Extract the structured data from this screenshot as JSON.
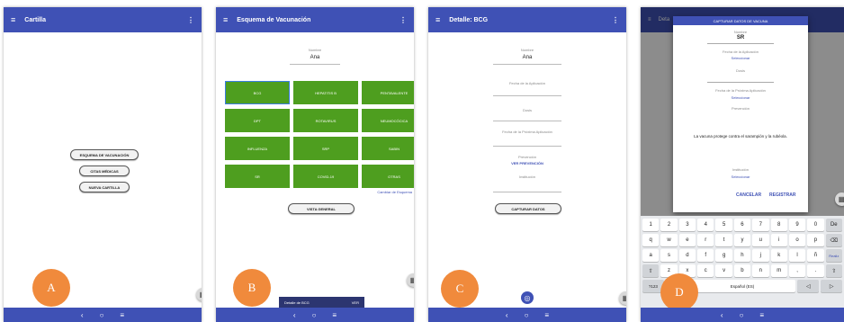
{
  "nav": {
    "back": "‹",
    "home": "○",
    "recents": "≡"
  },
  "icons": {
    "menu": "≡",
    "more": "⋮",
    "qr": "▦"
  },
  "screen_a": {
    "title": "Cartilla",
    "buttons": [
      "ESQUEMA DE VACUNACIÓN",
      "CITAS MÉDICAS",
      "NUEVA CARTILLA"
    ],
    "letter": "A"
  },
  "screen_b": {
    "title": "Esquema de Vacunación",
    "name_label": "Nombre",
    "name_value": "Ana",
    "vaccines": [
      "BCG",
      "HEPATITIS B",
      "PENTAVALENTE",
      "DPT",
      "ROTAVIRUS",
      "NEUMOCÓCICA",
      "INFLUENZA",
      "SRP",
      "SABIN",
      "SR",
      "COVID-19",
      "OTRAS"
    ],
    "selected_vaccine": "BCG",
    "change_link": "Cambiar de Esquema",
    "general_button": "VISTA GENERAL",
    "snackbar_text": "Detalle de BCG",
    "snackbar_action": "VER",
    "letter": "B"
  },
  "screen_c": {
    "title": "Detalle: BCG",
    "name_label": "Nombre",
    "name_value": "Ana",
    "field_fecha": "Fecha de la Aplicación",
    "field_dosis": "Dosis",
    "field_proxima": "Fecha de la Próxima Aplicación",
    "prevention_label": "Prevención",
    "prevention_link": "VER PREVENCIÓN",
    "institution_label": "Institución",
    "capture_button": "CAPTURAR DATOS",
    "letter": "C"
  },
  "screen_d": {
    "title": "Deta",
    "dialog_title": "CAPTURAR DATOS DE VACUNA",
    "name_label": "Nombre",
    "name_value": "SR",
    "fecha_label": "Fecha de la Aplicación",
    "select_1": "Seleccionar",
    "dosis_label": "Dosis",
    "proxima_label": "Fecha de la Próxima Aplicación",
    "select_2": "Seleccionar",
    "prevention_label": "Prevención",
    "prevention_text": "La vacuna protege contra el sarampión y la rubéola.",
    "institution_label": "Institución",
    "select_3": "Seleccionar",
    "cancel": "CANCELAR",
    "register": "REGISTRAR",
    "letter": "D",
    "keyboard": {
      "row1": [
        "1",
        "2",
        "3",
        "4",
        "5",
        "6",
        "7",
        "8",
        "9",
        "0",
        "De"
      ],
      "row2": [
        "q",
        "w",
        "e",
        "r",
        "t",
        "y",
        "u",
        "i",
        "o",
        "p",
        "⌫"
      ],
      "row3": [
        "a",
        "s",
        "d",
        "f",
        "g",
        "h",
        "j",
        "k",
        "l",
        "ñ",
        "Realiz"
      ],
      "row4": [
        "⇧",
        "z",
        "x",
        "c",
        "v",
        "b",
        "n",
        "m",
        ",",
        ".",
        "⇧"
      ],
      "row5": [
        "?123",
        "☺",
        "Español (ES)",
        "◁",
        "▷"
      ]
    }
  },
  "colors": {
    "primary": "#3f51b5",
    "vaccine_green": "#4e9e1f",
    "accent_orange": "#f08a3c"
  }
}
